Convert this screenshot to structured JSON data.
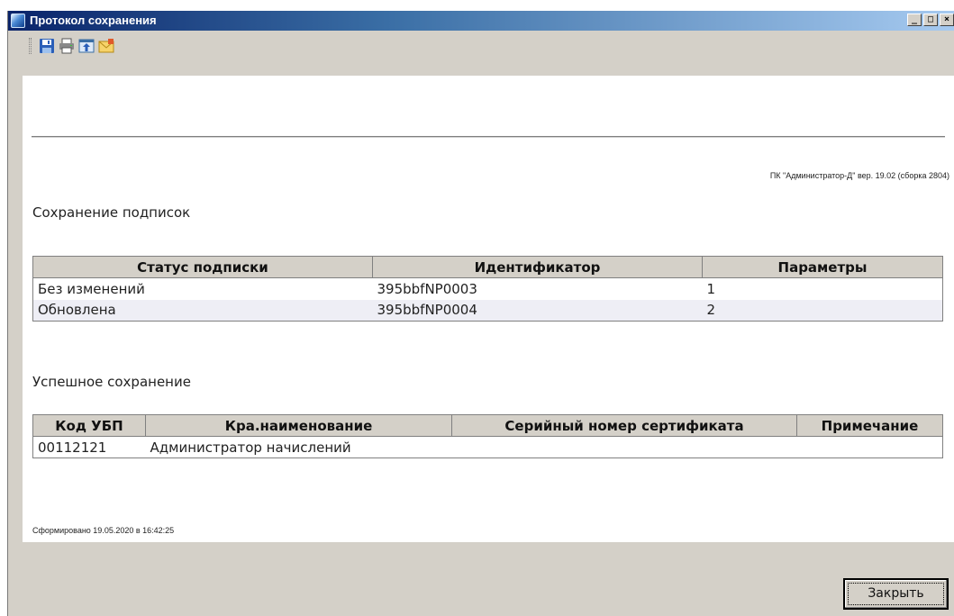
{
  "window": {
    "title": "Протокол сохранения",
    "controls": {
      "minimize": "_",
      "maximize": "□",
      "close": "×"
    }
  },
  "toolbar": {
    "items": [
      {
        "icon": "save-icon"
      },
      {
        "icon": "print-icon"
      },
      {
        "icon": "export-icon"
      },
      {
        "icon": "email-icon"
      }
    ]
  },
  "report": {
    "version": "ПК \"Администратор-Д\" вер. 19.02 (сборка 2804)",
    "subscriptions": {
      "title": "Сохранение подписок",
      "columns": [
        "Статус подписки",
        "Идентификатор",
        "Параметры"
      ],
      "rows": [
        [
          "Без изменений",
          "395bbfNP0003",
          "1"
        ],
        [
          "Обновлена",
          "395bbfNP0004",
          "2"
        ]
      ]
    },
    "success": {
      "title": "Успешное сохранение",
      "columns": [
        "Код УБП",
        "Кра.наименование",
        "Серийный номер сертификата",
        "Примечание"
      ],
      "rows": [
        [
          "00112121",
          "Администратор начислений",
          "",
          ""
        ]
      ]
    },
    "generated": "Сформировано 19.05.2020 в 16:42:25"
  },
  "footer": {
    "close_label": "Закрыть"
  },
  "colors": {
    "title_gradient_start": "#0a246a",
    "title_gradient_end": "#a6caf0",
    "alt_row": "#eeeef5"
  }
}
